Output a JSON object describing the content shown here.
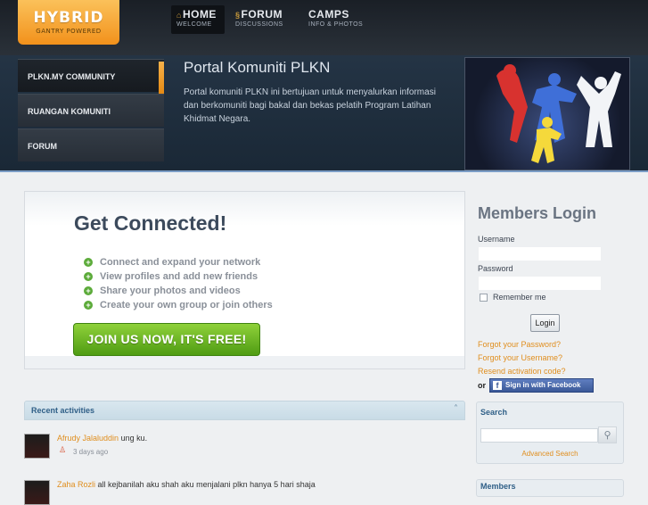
{
  "logo": {
    "name": "HYBRID",
    "tagline": "GANTRY POWERED"
  },
  "nav": [
    {
      "label": "HOME",
      "sub": "WELCOME",
      "icon": "home-icon"
    },
    {
      "label": "FORUM",
      "sub": "DISCUSSIONS",
      "icon": "forum-icon"
    },
    {
      "label": "CAMPS",
      "sub": "INFO & PHOTOS"
    }
  ],
  "sidebar": {
    "items": [
      {
        "label": "PLKN.MY COMMUNITY"
      },
      {
        "label": "RUANGAN KOMUNITI"
      },
      {
        "label": "FORUM"
      }
    ]
  },
  "banner": {
    "title": "Portal Komuniti PLKN",
    "description": "Portal komuniti PLKN ini bertujuan untuk menyalurkan informasi dan berkomuniti bagi bakal dan bekas pelatih Program Latihan Khidmat Negara."
  },
  "main": {
    "title": "Get Connected!",
    "features": [
      "Connect and expand your network",
      "View profiles and add new friends",
      "Share your photos and videos",
      "Create your own group or join others"
    ],
    "join_label": "JOIN US NOW, IT'S FREE!"
  },
  "login": {
    "title": "Members Login",
    "username_label": "Username",
    "password_label": "Password",
    "remember_label": "Remember me",
    "button_label": "Login",
    "forgot_password": "Forgot your Password?",
    "forgot_username": "Forgot your Username?",
    "resend": "Resend activation code?",
    "or_label": "or",
    "facebook_label": "Sign in with Facebook"
  },
  "recent": {
    "title": "Recent activities",
    "items": [
      {
        "user": "Afrudy Jalaluddin",
        "text": "ung ku.",
        "time": "3 days ago"
      },
      {
        "user": "Zaha Rozli",
        "text": "all kejbanilah aku shah aku menjalani plkn hanya 5 hari shaja"
      }
    ]
  },
  "search": {
    "title": "Search",
    "advanced": "Advanced Search"
  },
  "members": {
    "title": "Members"
  },
  "colors": {
    "accent": "#e08e1e",
    "join_green": "#5fae1f",
    "facebook": "#3b5998",
    "link_blue": "#2f5f87"
  }
}
